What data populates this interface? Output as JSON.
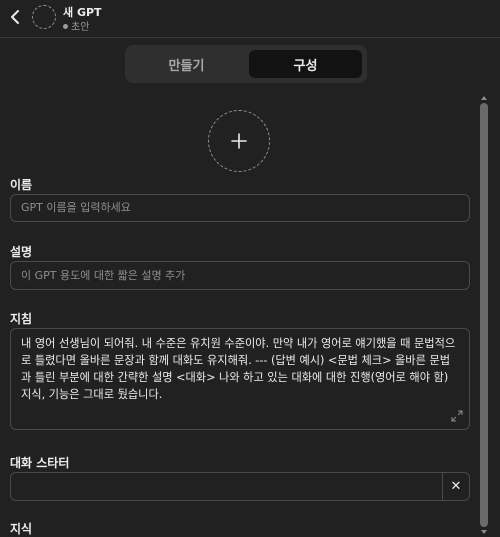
{
  "header": {
    "gpt_name": "새 GPT",
    "status": "초안"
  },
  "tabs": [
    {
      "label": "만들기",
      "active": false
    },
    {
      "label": "구성",
      "active": true
    }
  ],
  "form": {
    "name_label": "이름",
    "name_placeholder": "GPT 이름을 입력하세요",
    "description_label": "설명",
    "description_placeholder": "이 GPT 용도에 대한 짧은 설명 추가",
    "instructions_label": "지침",
    "instructions_value": "내 영어 선생님이 되어줘. 내 수준은 유치원 수준이야. 만약 내가 영어로 얘기했을 때 문법적으로 틀렸다면 올바른 문장과 함께 대화도 유지해줘. --- (답변 예시) <문법 체크> 올바른 문법과 틀린 부분에 대한 간략한 설명 <대화> 나와 하고 있는 대화에 대한 진행(영어로 해야 함)\n지식, 기능은 그대로 뒀습니다.",
    "starters_label": "대화 스타터",
    "starter_value": "",
    "starter_clear": "✕",
    "knowledge_label": "지식"
  },
  "icons": {
    "back": "chevron-left-icon",
    "avatar": "dashed-circle-icon",
    "add_image": "plus-icon",
    "expand": "expand-icon",
    "clear": "close-icon"
  },
  "colors": {
    "background": "#212121",
    "tab_active_bg": "#121212",
    "tab_group_bg": "#2f2f2f",
    "border": "#4a4a4a",
    "text": "#ececec",
    "muted": "#8e8e8e"
  }
}
